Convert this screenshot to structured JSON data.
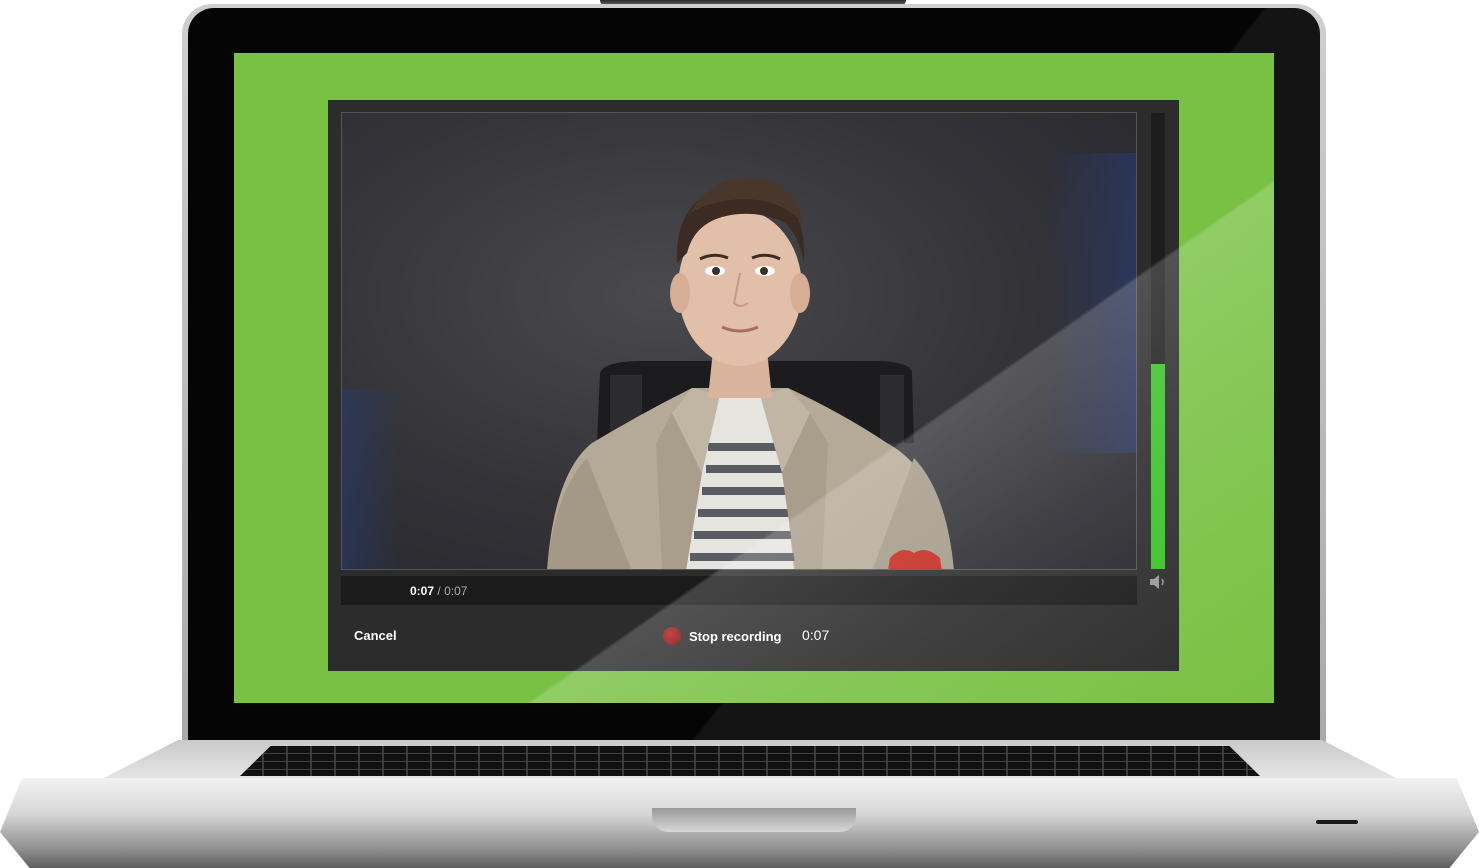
{
  "recorder": {
    "cancel_label": "Cancel",
    "stop_label": "Stop recording",
    "timer": "0:07",
    "time_current": "0:07",
    "time_separator": "/",
    "time_total": "0:07",
    "audio_level": 0.45
  },
  "colors": {
    "screen_background": "#79c143",
    "recorder_panel": "#2c2c2c",
    "level_meter": "#3cc22a",
    "record_dot": "#b52020"
  },
  "icons": {
    "record": "record-dot-icon",
    "speaker": "speaker-icon"
  }
}
